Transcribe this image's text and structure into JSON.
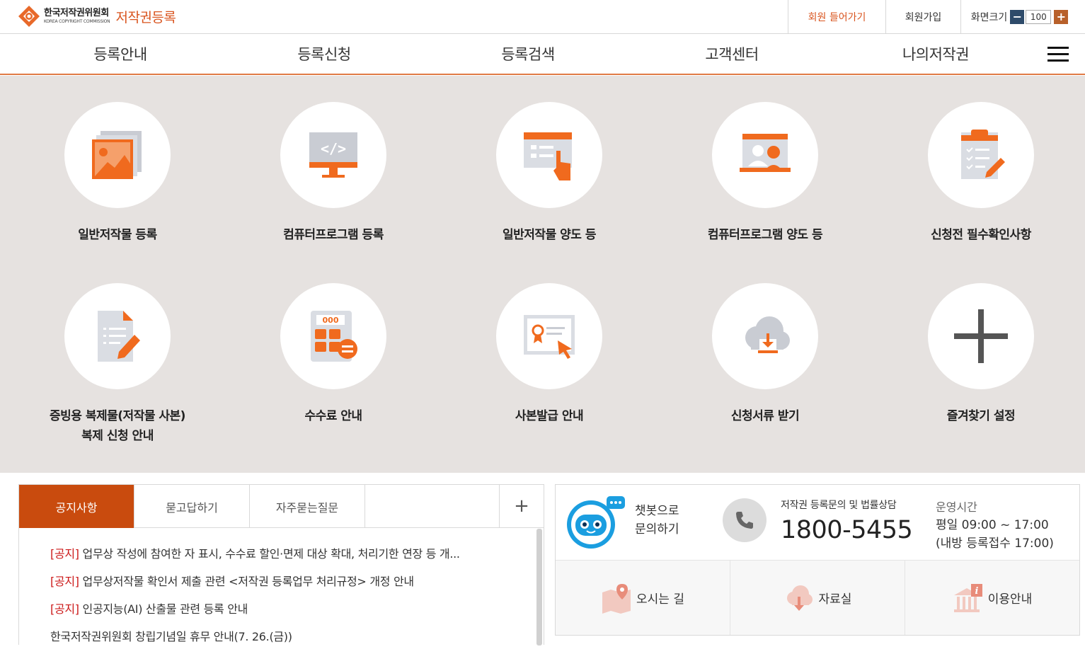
{
  "header": {
    "logo_ko": "한국저작권위원회",
    "logo_en": "KOREA COPYRIGHT COMMISSION",
    "site_title": "저작권등록",
    "login": "회원 들어가기",
    "join": "회원가입",
    "zoom_label": "화면크기",
    "zoom_minus": "−",
    "zoom_value": "100",
    "zoom_plus": "+"
  },
  "nav": [
    "등록안내",
    "등록신청",
    "등록검색",
    "고객센터",
    "나의저작권"
  ],
  "tiles": [
    {
      "label": "일반저작물 등록",
      "icon": "image-gallery-icon"
    },
    {
      "label": "컴퓨터프로그램 등록",
      "icon": "code-monitor-icon"
    },
    {
      "label": "일반저작물 양도 등",
      "icon": "document-hand-icon"
    },
    {
      "label": "컴퓨터프로그램 양도 등",
      "icon": "user-card-icon"
    },
    {
      "label": "신청전 필수확인사항",
      "icon": "checklist-icon"
    },
    {
      "label1": "증빙용 복제물(저작물 사본)",
      "label2": "복제 신청 안내",
      "icon": "document-pen-icon"
    },
    {
      "label": "수수료 안내",
      "icon": "calculator-icon"
    },
    {
      "label": "사본발급 안내",
      "icon": "certificate-icon"
    },
    {
      "label": "신청서류 받기",
      "icon": "cloud-download-icon"
    },
    {
      "label": "즐겨찾기 설정",
      "icon": "plus-icon"
    }
  ],
  "board": {
    "tabs": [
      "공지사항",
      "묻고답하기",
      "자주묻는질문"
    ],
    "more": "+",
    "notices": [
      {
        "tag": "[공지]",
        "text": " 업무상 작성에 참여한 자 표시, 수수료 할인·면제 대상 확대, 처리기한 연장 등 개..."
      },
      {
        "tag": "[공지]",
        "text": " 업무상저작물 확인서 제출 관련 <저작권 등록업무 처리규정> 개정 안내"
      },
      {
        "tag": "[공지]",
        "text": " 인공지능(AI) 산출물 관련 등록 안내"
      },
      {
        "tag": "",
        "text": "한국저작권위원회 창립기념일 휴무 안내(7. 26.(금))"
      }
    ]
  },
  "info": {
    "chatbot_line1": "챗봇으로",
    "chatbot_line2": "문의하기",
    "phone_label": "저작권 등록문의 및 법률상담",
    "phone_number": "1800-5455",
    "hours_title": "운영시간",
    "hours_line1": "평일 09:00 ~ 17:00",
    "hours_line2": "(내방 등록접수 17:00)",
    "quick_links": [
      "오시는 길",
      "자료실",
      "이용안내"
    ]
  },
  "colors": {
    "accent": "#d9541e",
    "tab_active": "#c94b0e",
    "icon_orange": "#f06a1e",
    "icon_gray": "#c9ccd3",
    "bg_grid": "#e6e2e0"
  }
}
